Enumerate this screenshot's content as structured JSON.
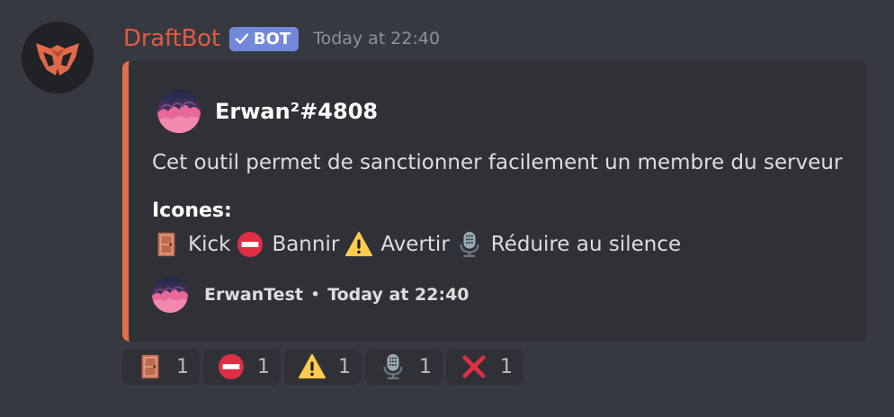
{
  "message": {
    "author": {
      "username": "DraftBot",
      "username_color": "#e05a44",
      "bot_tag": "BOT",
      "avatar_icon": "draftbot-logo-icon"
    },
    "timestamp": "Today at 22:40"
  },
  "embed": {
    "accent_color": "#e06f4f",
    "author_name": "Erwan²#4808",
    "description": "Cet outil permet de sanctionner facilement un membre du serveur",
    "field": {
      "name": "Icones:",
      "items": [
        {
          "icon": "door-icon",
          "label": "Kick"
        },
        {
          "icon": "no-entry-icon",
          "label": "Bannir"
        },
        {
          "icon": "warning-icon",
          "label": "Avertir"
        },
        {
          "icon": "microphone-icon",
          "label": "Réduire au silence"
        }
      ]
    },
    "footer": {
      "name": "ErwanTest",
      "separator": "•",
      "timestamp": "Today at 22:40"
    }
  },
  "reactions": [
    {
      "icon": "door-icon",
      "count": "1"
    },
    {
      "icon": "no-entry-icon",
      "count": "1"
    },
    {
      "icon": "warning-icon",
      "count": "1"
    },
    {
      "icon": "microphone-icon",
      "count": "1"
    },
    {
      "icon": "cross-mark-icon",
      "count": "1"
    }
  ]
}
